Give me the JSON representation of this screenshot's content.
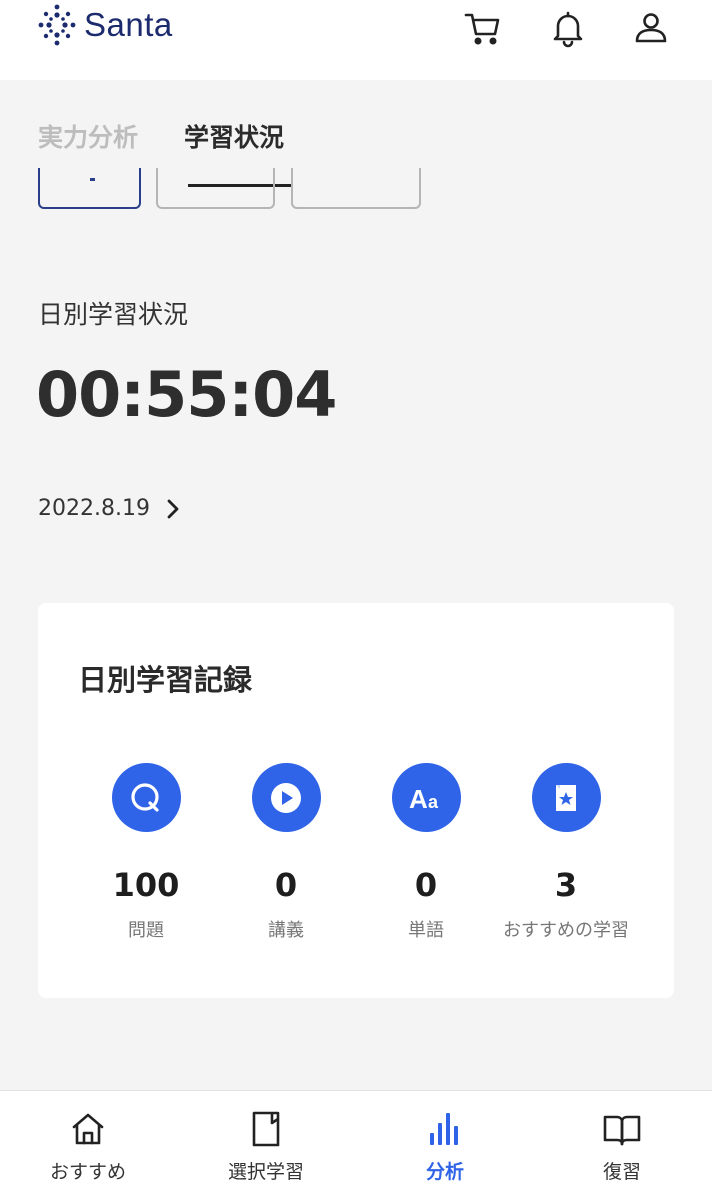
{
  "header": {
    "logo_text": "Santa",
    "icons": [
      "cart-icon",
      "bell-icon",
      "user-icon"
    ]
  },
  "tabs": [
    {
      "label": "実力分析",
      "active": false
    },
    {
      "label": "学習状況",
      "active": true
    }
  ],
  "daily": {
    "label": "日別学習状況",
    "time": "00:55:04",
    "date": "2022.8.19"
  },
  "record_card": {
    "title": "日別学習記録",
    "stats": [
      {
        "icon": "question-icon",
        "value": "100",
        "label": "問題"
      },
      {
        "icon": "play-icon",
        "value": "0",
        "label": "講義"
      },
      {
        "icon": "vocabulary-icon",
        "value": "0",
        "label": "単語"
      },
      {
        "icon": "bookmark-star-icon",
        "value": "3",
        "label": "おすすめの学習"
      }
    ]
  },
  "bottom_nav": [
    {
      "icon": "home-icon",
      "label": "おすすめ",
      "active": false
    },
    {
      "icon": "notebook-icon",
      "label": "選択学習",
      "active": false
    },
    {
      "icon": "bar-chart-icon",
      "label": "分析",
      "active": true
    },
    {
      "icon": "open-book-icon",
      "label": "復習",
      "active": false
    }
  ],
  "colors": {
    "accent": "#2f63e8",
    "brand": "#1c2a6e",
    "background": "#f4f4f4"
  }
}
